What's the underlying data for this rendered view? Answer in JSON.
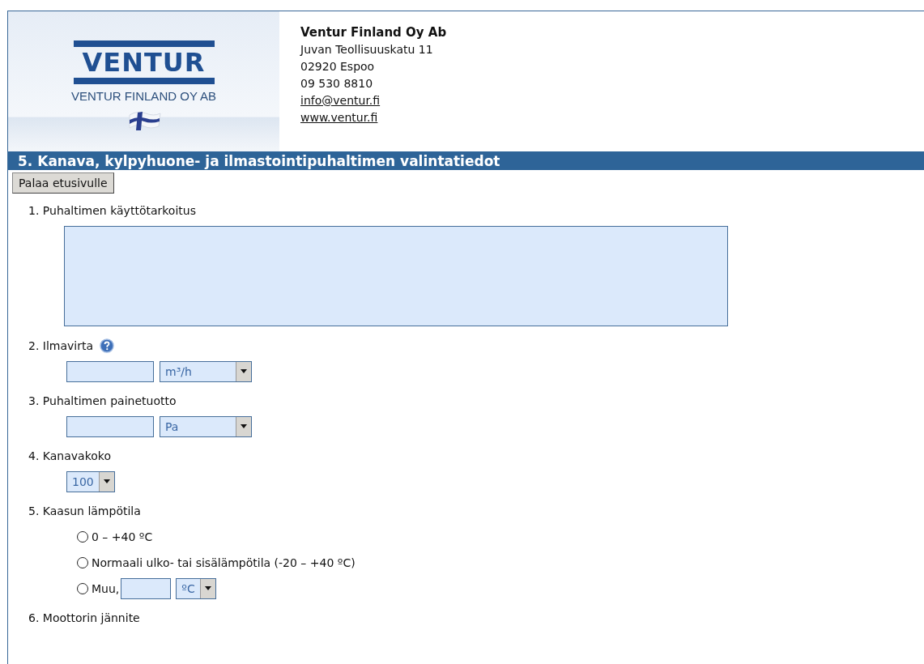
{
  "logo": {
    "wordmark": "VENTUR",
    "subtitle": "VENTUR FINLAND OY AB"
  },
  "company": {
    "name": "Ventur Finland Oy Ab",
    "lines": [
      "Juvan Teollisuuskatu 11",
      "02920 Espoo",
      "09 530 8810"
    ],
    "links": [
      "info@ventur.fi",
      "www.ventur.fi"
    ]
  },
  "section_title": "5. Kanava, kylpyhuone- ja ilmastointipuhaltimen valintatiedot",
  "back_button": "Palaa etusivulle",
  "questions": [
    {
      "kind": "textarea",
      "label": "1. Puhaltimen käyttötarkoitus"
    },
    {
      "kind": "value_unit",
      "label": "2. Ilmavirta",
      "help": true,
      "unit": "m³/h"
    },
    {
      "kind": "value_unit",
      "label": "3. Puhaltimen painetuotto",
      "help": false,
      "unit": "Pa"
    },
    {
      "kind": "select",
      "label": "4. Kanavakoko",
      "value": "100"
    },
    {
      "kind": "radios",
      "label": "5. Kaasun lämpötila",
      "options": [
        {
          "kind": "plain",
          "label": "0 – +40 ºC",
          "selected": false
        },
        {
          "kind": "plain",
          "label": "Normaali ulko- tai sisälämpötila (-20 – +40 ºC)",
          "selected": false
        },
        {
          "kind": "other",
          "label": "Muu,",
          "unit": "ºC",
          "selected": false
        }
      ]
    },
    {
      "kind": "heading",
      "label": "6. Moottorin jännite"
    }
  ]
}
